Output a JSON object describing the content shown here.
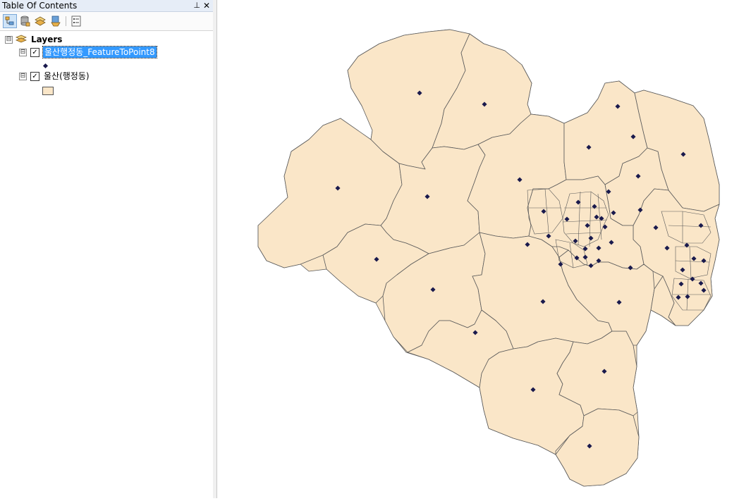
{
  "toc": {
    "title": "Table Of Contents",
    "pin_glyph": "⊥",
    "close_glyph": "✕",
    "toolbar": [
      {
        "name": "list-by-drawing-order-icon",
        "active": true
      },
      {
        "name": "list-by-source-icon",
        "active": false
      },
      {
        "name": "list-by-visibility-icon",
        "active": false
      },
      {
        "name": "list-by-selection-icon",
        "active": false
      },
      {
        "name": "options-icon",
        "active": false
      }
    ],
    "root": {
      "label": "Layers",
      "expander": "⊟"
    },
    "layers": [
      {
        "label": "울산행정동_FeatureToPoint8",
        "checked": true,
        "selected": true,
        "symbol": "point",
        "expander": "⊟"
      },
      {
        "label": "울산(행정동)",
        "checked": true,
        "selected": false,
        "symbol": "polygon",
        "expander": "⊟"
      }
    ]
  },
  "map": {
    "fill_color": "#fae6c8",
    "outline_color": "#5a5a5a",
    "point_color": "#1a1a4d"
  }
}
